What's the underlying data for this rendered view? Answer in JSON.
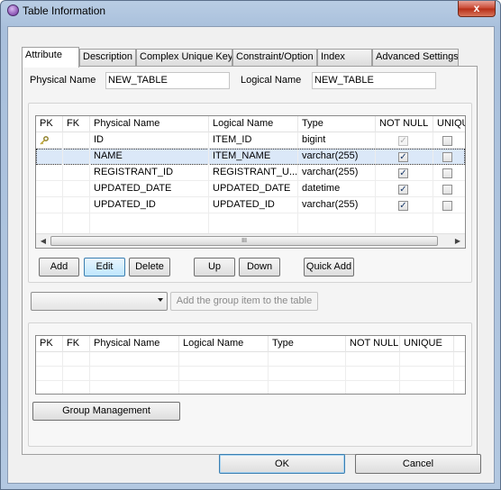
{
  "window": {
    "title": "Table Information",
    "close_glyph": "x"
  },
  "tabs": [
    {
      "label": "Attribute"
    },
    {
      "label": "Description"
    },
    {
      "label": "Complex Unique Key"
    },
    {
      "label": "Constraint/Option"
    },
    {
      "label": "Index"
    },
    {
      "label": "Advanced Settings"
    }
  ],
  "form": {
    "physical_name_label": "Physical Name",
    "physical_name_value": "NEW_TABLE",
    "logical_name_label": "Logical Name",
    "logical_name_value": "NEW_TABLE"
  },
  "columns_table": {
    "headers": [
      "PK",
      "FK",
      "Physical Name",
      "Logical Name",
      "Type",
      "NOT NULL",
      "UNIQU"
    ],
    "rows": [
      {
        "pk": "key-icon",
        "physical": "ID",
        "logical": "ITEM_ID",
        "type": "bigint",
        "not_null": true,
        "not_null_disabled": true,
        "unique": false
      },
      {
        "pk": "",
        "physical": "NAME",
        "logical": "ITEM_NAME",
        "type": "varchar(255)",
        "not_null": true,
        "not_null_disabled": false,
        "unique": false,
        "selected": true
      },
      {
        "pk": "",
        "physical": "REGISTRANT_ID",
        "logical": "REGISTRANT_U...",
        "type": "varchar(255)",
        "not_null": true,
        "not_null_disabled": false,
        "unique": false
      },
      {
        "pk": "",
        "physical": "UPDATED_DATE",
        "logical": "UPDATED_DATE",
        "type": "datetime",
        "not_null": true,
        "not_null_disabled": false,
        "unique": false
      },
      {
        "pk": "",
        "physical": "UPDATED_ID",
        "logical": "UPDATED_ID",
        "type": "varchar(255)",
        "not_null": true,
        "not_null_disabled": false,
        "unique": false
      }
    ],
    "scroll_thumb_grip": "III"
  },
  "buttons": {
    "add": "Add",
    "edit": "Edit",
    "delete": "Delete",
    "up": "Up",
    "down": "Down",
    "quick_add": "Quick Add",
    "add_group": "Add the group item to the table",
    "group_management": "Group Management",
    "ok": "OK",
    "cancel": "Cancel"
  },
  "group_combo": {
    "selected": ""
  },
  "group_table": {
    "headers": [
      "PK",
      "FK",
      "Physical Name",
      "Logical Name",
      "Type",
      "NOT NULL",
      "UNIQUE"
    ]
  }
}
